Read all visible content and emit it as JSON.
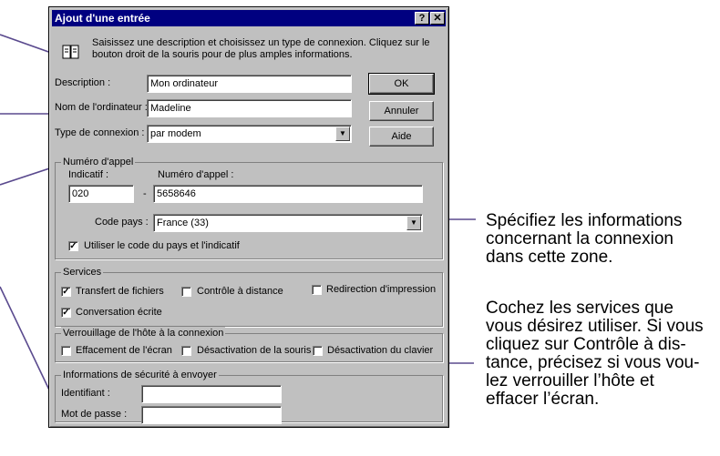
{
  "dialog": {
    "title": "Ajout d'une entrée",
    "help_button": "?",
    "close_button": "✕",
    "intro_line1": "Saisissez une description et choisissez un type de connexion. Cliquez sur le",
    "intro_line2": "bouton droit de la souris pour de plus amples informations.",
    "description_label": "Description :",
    "description_value": "Mon ordinateur",
    "computer_label": "Nom de l'ordinateur :",
    "computer_value": "Madeline",
    "conn_type_label": "Type de connexion :",
    "conn_type_value": "par modem",
    "ok_label": "OK",
    "cancel_label": "Annuler",
    "help_label": "Aide"
  },
  "phone": {
    "group_title": "Numéro d'appel",
    "prefix_label": "Indicatif :",
    "number_label": "Numéro d'appel :",
    "prefix_value": "020",
    "dash": "-",
    "number_value": "5658646",
    "country_label": "Code pays :",
    "country_value": "France (33)",
    "use_country_label": "Utiliser le code du pays et l'indicatif",
    "use_country_checked": "✓"
  },
  "services": {
    "group_title": "Services",
    "file_transfer": "Transfert de fichiers",
    "file_transfer_checked": "✓",
    "remote_control": "Contrôle à distance",
    "print_redirect": "Redirection d'impression",
    "chat": "Conversation écrite",
    "chat_checked": "✓"
  },
  "lock": {
    "group_title": "Verrouillage de l'hôte à la connexion",
    "clear_screen": "Effacement de l'écran",
    "disable_mouse": "Désactivation de la souris",
    "disable_keyboard": "Désactivation du clavier"
  },
  "security": {
    "group_title": "Informations de sécurité à envoyer",
    "id_label": "Identifiant :",
    "id_value": "",
    "pwd_label": "Mot de passe :",
    "pwd_value": ""
  },
  "annotations": {
    "note1": [
      "Spécifiez les informations",
      "concernant la connexion",
      "dans cette zone."
    ],
    "note2": [
      "Cochez les services que",
      "vous désirez utiliser. Si vous",
      "cliquez sur Contrôle à dis-",
      "tance, précisez si vous vou-",
      "lez verrouiller l’hôte et",
      "effacer l’écran."
    ]
  },
  "colors": {
    "titlebar": "#000080",
    "dialog_bg": "#c0c0c0",
    "callout_line": "#5a4a8e"
  }
}
